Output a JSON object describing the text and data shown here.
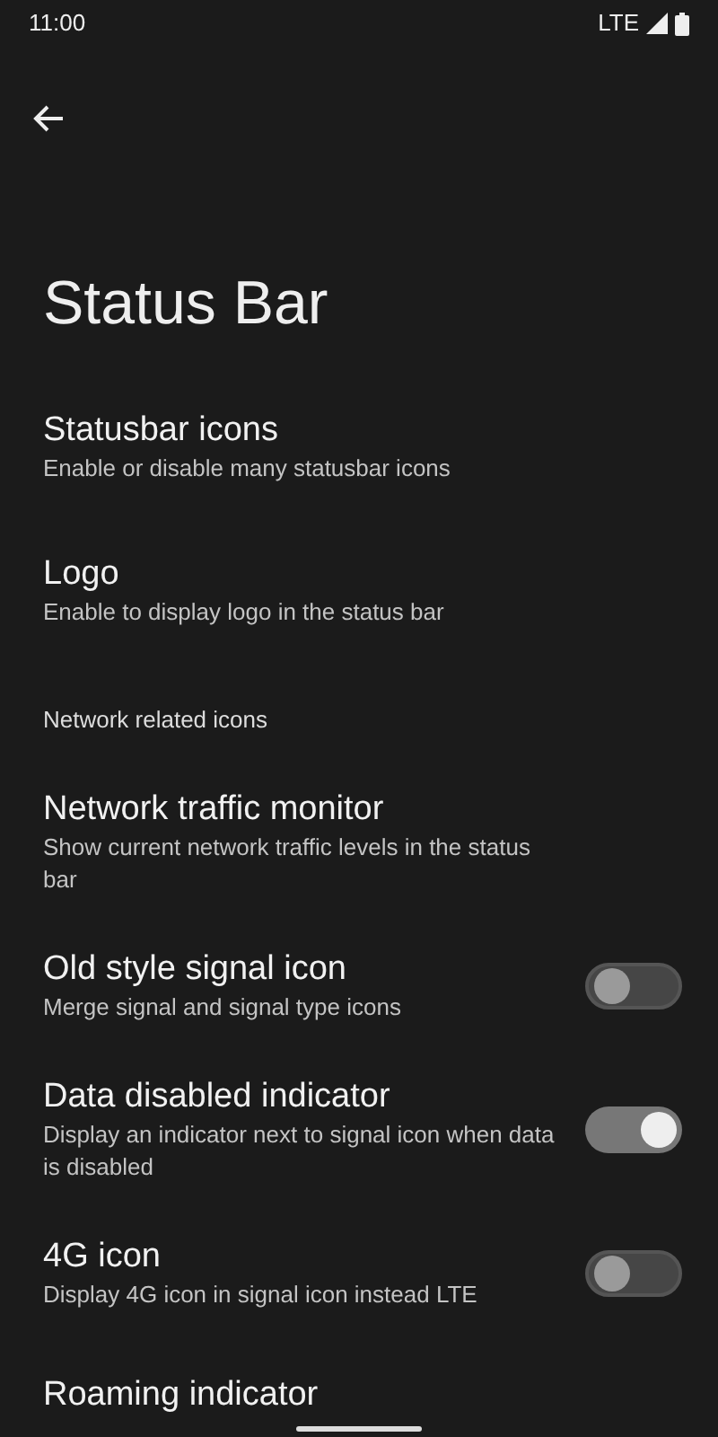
{
  "status_bar": {
    "time": "11:00",
    "network": "LTE"
  },
  "title": "Status Bar",
  "items": [
    {
      "kind": "link",
      "title": "Statusbar icons",
      "summary": "Enable or disable many statusbar icons"
    },
    {
      "kind": "link",
      "title": "Logo",
      "summary": "Enable to display logo in the status bar"
    },
    {
      "kind": "header",
      "title": "Network related icons"
    },
    {
      "kind": "link",
      "title": "Network traffic monitor",
      "summary": "Show current network traffic levels in the status bar"
    },
    {
      "kind": "switch",
      "title": "Old style signal icon",
      "summary": "Merge signal and signal type icons",
      "on": false
    },
    {
      "kind": "switch",
      "title": "Data disabled indicator",
      "summary": "Display an indicator next to signal icon when data is disabled",
      "on": true
    },
    {
      "kind": "switch",
      "title": "4G icon",
      "summary": "Display 4G icon in signal icon instead LTE",
      "on": false
    },
    {
      "kind": "link",
      "title": "Roaming indicator"
    }
  ]
}
